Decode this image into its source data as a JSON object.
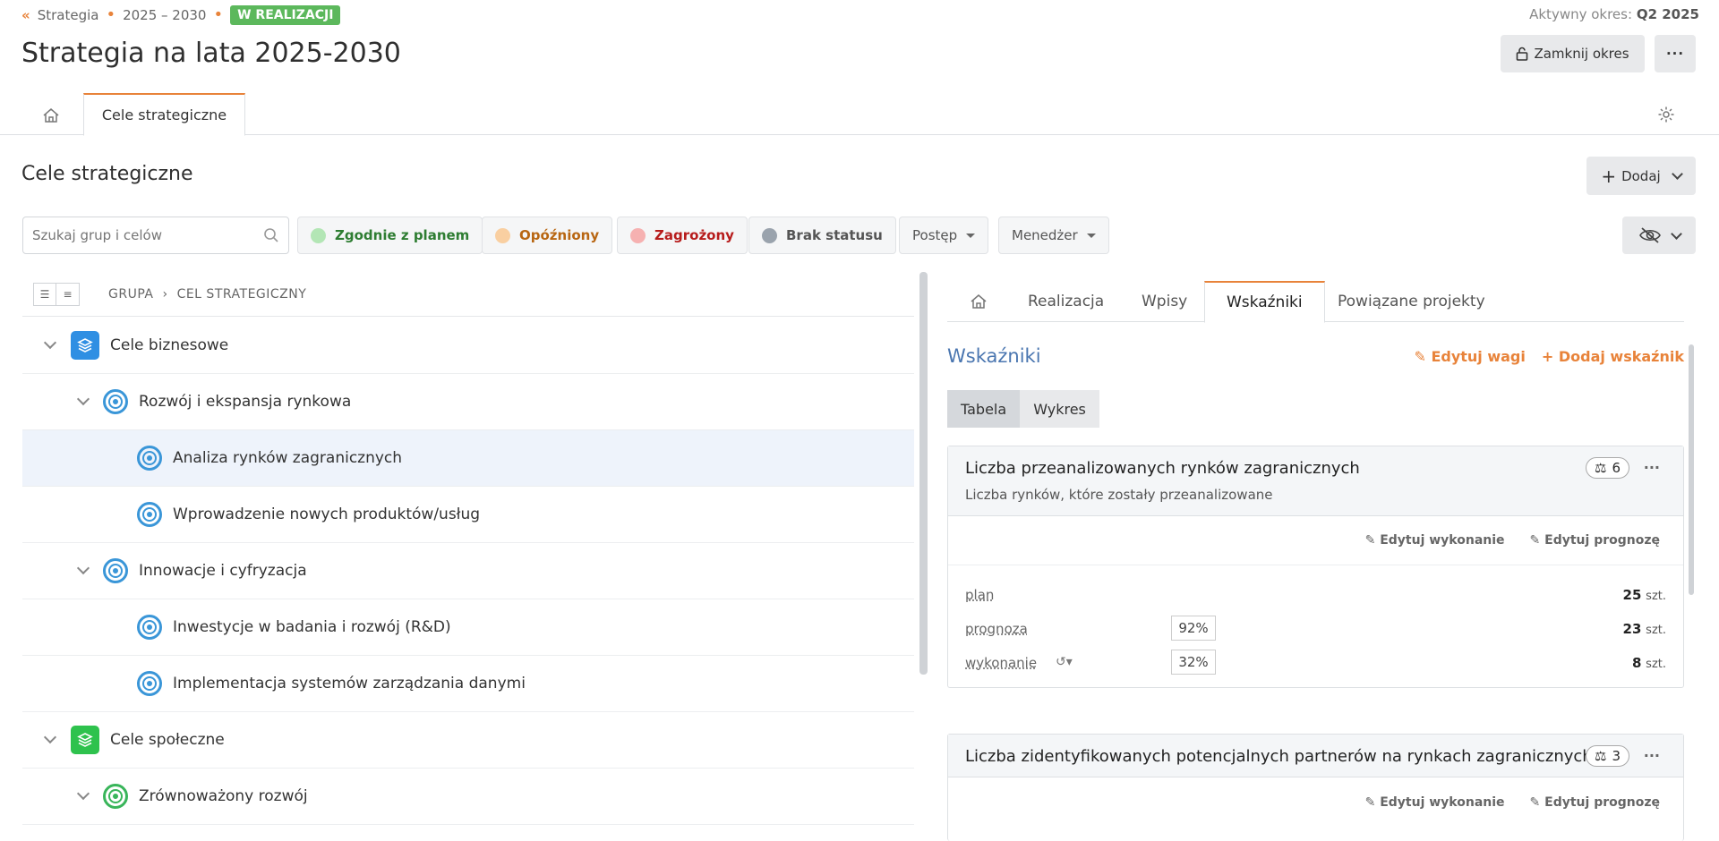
{
  "breadcrumb": {
    "root": "Strategia",
    "period": "2025 – 2030",
    "status": "W REALIZACJI"
  },
  "active_period": {
    "label": "Aktywny okres:",
    "value": "Q2 2025"
  },
  "page_title": "Strategia na lata 2025-2030",
  "header": {
    "close_label": "Zamknij okres",
    "more_label": "···"
  },
  "main_tabs": {
    "cele": "Cele strategiczne"
  },
  "section": {
    "title": "Cele strategiczne",
    "add_label": "Dodaj"
  },
  "search": {
    "placeholder": "Szukaj grup i celów"
  },
  "filters": [
    {
      "label": "Zgodnie z planem",
      "color": "#8fd694",
      "text": "#2e7d32"
    },
    {
      "label": "Opóźniony",
      "color": "#f7c899",
      "text": "#c26a12"
    },
    {
      "label": "Zagrożony",
      "color": "#f5a3a3",
      "text": "#c62828"
    },
    {
      "label": "Brak statusu",
      "color": "#9aa3ad",
      "text": "#555"
    }
  ],
  "dropdowns": {
    "progress": "Postęp",
    "manager": "Menedżer"
  },
  "tree": {
    "crumb_group": "GRUPA",
    "crumb_goal": "CEL STRATEGICZNY",
    "rows": [
      {
        "label": "Cele biznesowe"
      },
      {
        "label": "Rozwój i ekspansja rynkowa"
      },
      {
        "label": "Analiza rynków zagranicznych"
      },
      {
        "label": "Wprowadzenie nowych produktów/usług"
      },
      {
        "label": "Innowacje i cyfryzacja"
      },
      {
        "label": "Inwestycje w badania i rozwój (R&D)"
      },
      {
        "label": "Implementacja systemów zarządzania danymi"
      },
      {
        "label": "Cele społeczne"
      },
      {
        "label": "Zrównoważony rozwój"
      }
    ]
  },
  "detail": {
    "tabs": {
      "realizacja": "Realizacja",
      "wpisy": "Wpisy",
      "wskazniki": "Wskaźniki",
      "projekty": "Powiązane projekty"
    },
    "title": "Wskaźniki",
    "edit_weights": "Edytuj wagi",
    "add_indicator": "Dodaj wskaźnik",
    "view_table": "Tabela",
    "view_chart": "Wykres",
    "edit_exec": "Edytuj wykonanie",
    "edit_forecast": "Edytuj prognozę",
    "indicators": [
      {
        "title": "Liczba przeanalizowanych rynków zagranicznych",
        "desc": "Liczba rynków, które zostały przeanalizowane",
        "weight": "6",
        "plan_label": "plan",
        "plan_value": "25",
        "forecast_label": "prognoza",
        "forecast_pct": "92%",
        "forecast_value": "23",
        "exec_label": "wykonanie",
        "exec_pct": "32%",
        "exec_value": "8",
        "unit": "szt."
      },
      {
        "title": "Liczba zidentyfikowanych potencjalnych partnerów na rynkach zagranicznych",
        "weight": "3"
      }
    ]
  }
}
